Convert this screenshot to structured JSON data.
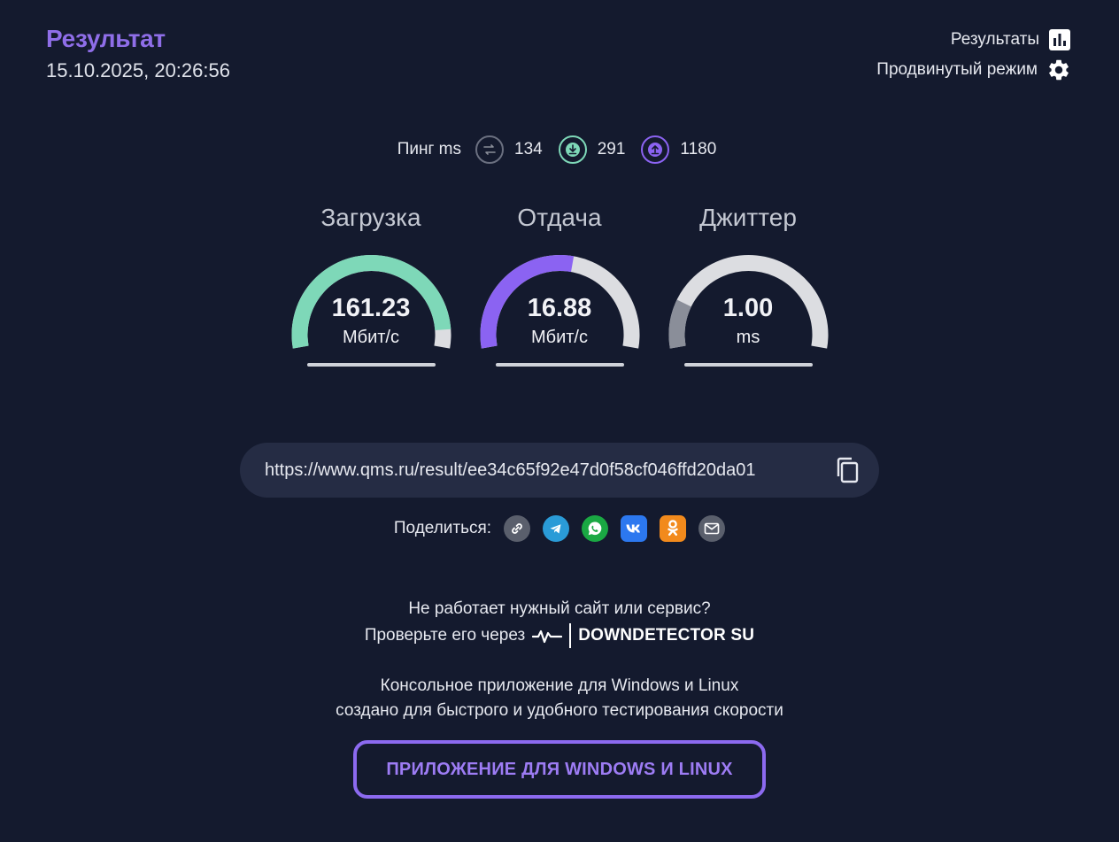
{
  "header": {
    "title": "Результат",
    "datetime": "15.10.2025, 20:26:56",
    "results_link": "Результаты",
    "advanced_link": "Продвинутый режим"
  },
  "ping": {
    "label": "Пинг ms",
    "idle": "134",
    "download": "291",
    "upload": "1180"
  },
  "gauges": [
    {
      "title": "Загрузка",
      "value": "161.23",
      "unit": "Мбит/с",
      "fill_fraction": 0.93,
      "color": "#7ed8b8"
    },
    {
      "title": "Отдача",
      "value": "16.88",
      "unit": "Мбит/с",
      "fill_fraction": 0.55,
      "color": "#8b63f2"
    },
    {
      "title": "Джиттер",
      "value": "1.00",
      "unit": "ms",
      "fill_fraction": 0.18,
      "color": "#8a8e99"
    }
  ],
  "result_url": "https://www.qms.ru/result/ee34c65f92e47d0f58cf046ffd20da01",
  "share": {
    "label": "Поделиться:",
    "icons": [
      "link-icon",
      "telegram-icon",
      "whatsapp-icon",
      "vk-icon",
      "odnoklassniki-icon",
      "email-icon"
    ]
  },
  "downdetector": {
    "line1": "Не работает нужный сайт или сервис?",
    "line2": "Проверьте его через",
    "brand": "DOWNDETECTOR SU"
  },
  "console": {
    "line1": "Консольное приложение для Windows и Linux",
    "line2": "создано для быстрого и удобного тестирования скорости",
    "button": "ПРИЛОЖЕНИЕ ДЛЯ WINDOWS И LINUX"
  },
  "colors": {
    "background": "#141a2e",
    "accent": "#8f6ee8",
    "download": "#7ed8b8",
    "upload": "#8b63f2",
    "track": "#dcdde1"
  }
}
